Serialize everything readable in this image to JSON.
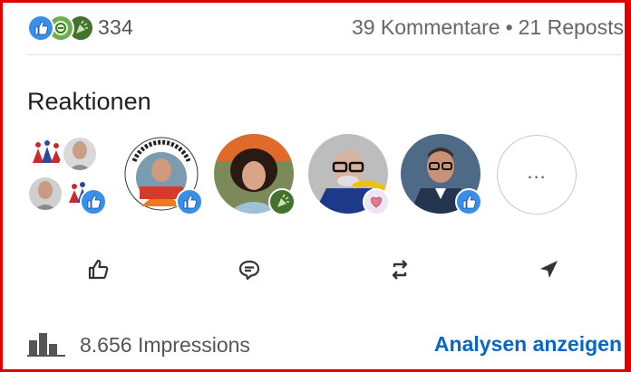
{
  "summary": {
    "reaction_icons": [
      "like-icon",
      "support-icon",
      "celebrate-icon"
    ],
    "reaction_count": "334",
    "comments": "39 Kommentare",
    "separator": "•",
    "reposts": "21 Reposts"
  },
  "reactions": {
    "title": "Reaktionen",
    "people": [
      {
        "name": "reactor-1",
        "badge": "like-icon"
      },
      {
        "name": "reactor-2",
        "badge": "like-icon"
      },
      {
        "name": "reactor-3",
        "badge": "celebrate-icon"
      },
      {
        "name": "reactor-4",
        "badge": "love-icon"
      },
      {
        "name": "reactor-5",
        "badge": "like-icon"
      }
    ],
    "more_label": "..."
  },
  "actions": [
    {
      "name": "like-action",
      "icon": "thumbs-up-icon"
    },
    {
      "name": "comment-action",
      "icon": "comment-icon"
    },
    {
      "name": "repost-action",
      "icon": "repost-icon"
    },
    {
      "name": "send-action",
      "icon": "send-icon"
    }
  ],
  "footer": {
    "impressions": "8.656 Impressions",
    "analytics_link": "Analysen anzeigen"
  },
  "colors": {
    "accent": "#0a66c2",
    "like": "#378fe9",
    "celebrate": "#44712e",
    "support": "#6dae4f",
    "border": "#e00000"
  }
}
